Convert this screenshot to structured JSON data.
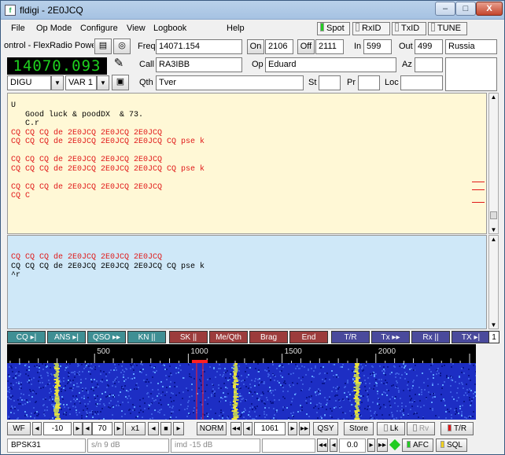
{
  "window": {
    "title": "fldigi - 2E0JCQ",
    "min": "–",
    "max": "□",
    "close": "X",
    "app_icon": "fldigi-icon"
  },
  "menu": {
    "file": "File",
    "opmode": "Op Mode",
    "configure": "Configure",
    "view": "View",
    "logbook": "Logbook",
    "help": "Help",
    "spot": "Spot",
    "rxid": "RxID",
    "txid": "TxID",
    "tune": "TUNE"
  },
  "rig": {
    "name": "ontrol - FlexRadio Powe",
    "freq": "14070.093",
    "mode": "DIGU",
    "var": "VAR 1"
  },
  "log": {
    "freq_label": "Freq",
    "freq": "14071.154",
    "on_label": "On",
    "on": "2106",
    "off_label": "Off",
    "off": "2111",
    "in_label": "In",
    "in": "599",
    "out_label": "Out",
    "out": "499",
    "country": "Russia",
    "call_label": "Call",
    "call": "RA3IBB",
    "op_label": "Op",
    "op": "Eduard",
    "az_label": "Az",
    "az": "",
    "qth_label": "Qth",
    "qth": "Tver",
    "st_label": "St",
    "st": "",
    "pr_label": "Pr",
    "pr": "",
    "loc_label": "Loc",
    "loc": ""
  },
  "rx_text": [
    {
      "t": "U",
      "c": "#000"
    },
    {
      "t": "   Good luck & poodDX  & 73.",
      "c": "#000"
    },
    {
      "t": "   C.r",
      "c": "#000"
    },
    {
      "t": "CQ CQ CQ de 2E0JCQ 2E0JCQ 2E0JCQ",
      "c": "#e01818"
    },
    {
      "t": "CQ CQ CQ de 2E0JCQ 2E0JCQ 2E0JCQ CQ pse k",
      "c": "#e01818"
    },
    {
      "t": "",
      "c": "#000"
    },
    {
      "t": "CQ CQ CQ de 2E0JCQ 2E0JCQ 2E0JCQ",
      "c": "#e01818"
    },
    {
      "t": "CQ CQ CQ de 2E0JCQ 2E0JCQ 2E0JCQ CQ pse k",
      "c": "#e01818"
    },
    {
      "t": "",
      "c": "#000"
    },
    {
      "t": "CQ CQ CQ de 2E0JCQ 2E0JCQ 2E0JCQ",
      "c": "#e01818"
    },
    {
      "t": "CQ C",
      "c": "#e01818"
    }
  ],
  "tx_text": [
    {
      "t": "CQ CQ CQ de 2E0JCQ 2E0JCQ 2E0JCQ",
      "c": "#e01818"
    },
    {
      "t": "CQ CQ CQ de 2E0JCQ 2E0JCQ 2E0JCQ CQ pse k",
      "c": "#000"
    },
    {
      "t": "^r",
      "c": "#000"
    }
  ],
  "macros": [
    {
      "label": "CQ ▸|",
      "bg": "#3f8f94"
    },
    {
      "label": "ANS ▸|",
      "bg": "#3f8f94"
    },
    {
      "label": "QSO ▸▸",
      "bg": "#3f8f94"
    },
    {
      "label": "KN ||",
      "bg": "#3f8f94"
    },
    {
      "label": "SK ||",
      "bg": "#9c3c3c"
    },
    {
      "label": "Me/Qth",
      "bg": "#9c3c3c"
    },
    {
      "label": "Brag",
      "bg": "#9c3c3c"
    },
    {
      "label": "End",
      "bg": "#9c3c3c"
    },
    {
      "label": "T/R",
      "bg": "#4a4a9c"
    },
    {
      "label": "Tx ▸▸",
      "bg": "#4a4a9c"
    },
    {
      "label": "Rx ||",
      "bg": "#4a4a9c"
    },
    {
      "label": "TX ▸|",
      "bg": "#4a4a9c"
    }
  ],
  "macro_set": "1",
  "ruler": {
    "ticks": [
      "500",
      "1000",
      "1500",
      "2000"
    ]
  },
  "controls": {
    "wf": "WF",
    "ref": "-10",
    "range": "70",
    "zoom": "x1",
    "norm": "NORM",
    "wf_freq": "1061",
    "qsy": "QSY",
    "store": "Store",
    "lk": "Lk",
    "rv": "Rv",
    "tr": "T/R"
  },
  "status": {
    "mode": "BPSK31",
    "sn": "s/n  9 dB",
    "imd": "imd -15 dB",
    "offset": "0.0",
    "afc": "AFC",
    "sql": "SQL"
  },
  "colors": {
    "rx_bg": "#fff8d6",
    "tx_bg": "#cfe8f8",
    "freq_display": "#1ed11e"
  }
}
